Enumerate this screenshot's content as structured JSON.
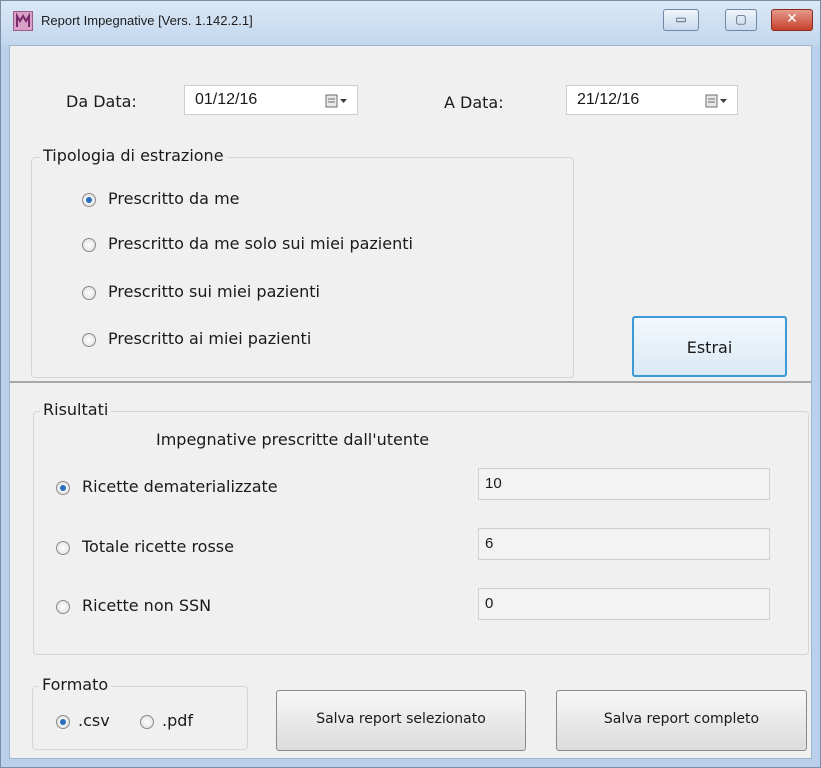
{
  "window": {
    "title": "Report Impegnative [Vers. 1.142.2.1]",
    "controls": {
      "minimize": "▭",
      "maximize": "▢",
      "close": "✕"
    }
  },
  "dates": {
    "from_label": "Da Data:",
    "from_value": "01/12/16",
    "to_label": "A Data:",
    "to_value": "21/12/16"
  },
  "extraction": {
    "title": "Tipologia di estrazione",
    "options": [
      {
        "label": "Prescritto da me",
        "selected": true
      },
      {
        "label": "Prescritto da me solo sui miei pazienti",
        "selected": false
      },
      {
        "label": "Prescritto sui miei pazienti",
        "selected": false
      },
      {
        "label": "Prescritto ai miei pazienti",
        "selected": false
      }
    ],
    "button_label": "Estrai"
  },
  "results": {
    "title": "Risultati",
    "subtitle": "Impegnative prescritte dall'utente",
    "rows": [
      {
        "label": "Ricette dematerializzate",
        "value": "10",
        "selected": true
      },
      {
        "label": "Totale ricette rosse",
        "value": "6",
        "selected": false
      },
      {
        "label": "Ricette non SSN",
        "value": "0",
        "selected": false
      }
    ]
  },
  "format": {
    "title": "Formato",
    "options": [
      {
        "label": ".csv",
        "selected": true
      },
      {
        "label": ".pdf",
        "selected": false
      }
    ]
  },
  "actions": {
    "save_selected": "Salva report selezionato",
    "save_complete": "Salva report completo"
  },
  "colors": {
    "titlebar": "#c9dcf0",
    "accent": "#3c9ad6",
    "radio_dot": "#2a6fbf",
    "close_button": "#c6402a"
  }
}
